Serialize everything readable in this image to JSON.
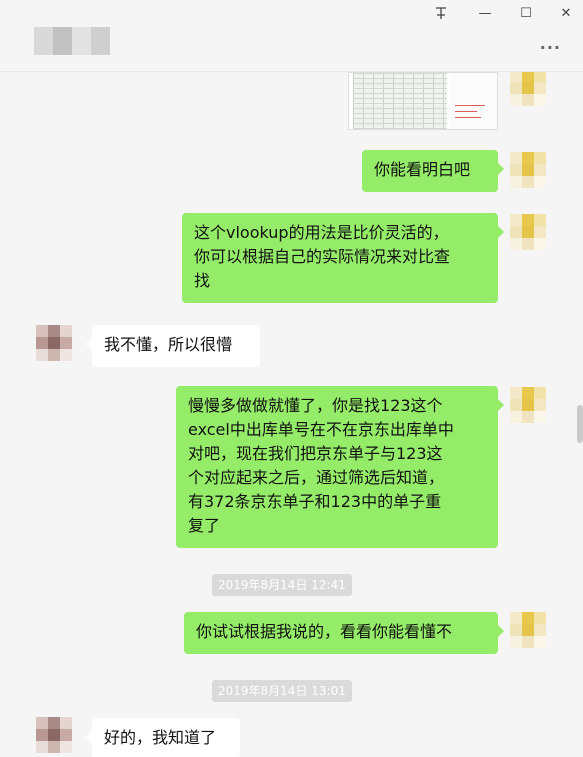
{
  "window": {
    "pin_icon": "pin-icon",
    "minimize_label": "—",
    "maximize_label": "☐",
    "close_label": "✕",
    "more_label": "···"
  },
  "messages": [
    {
      "id": "m1",
      "type": "image",
      "sender": "me"
    },
    {
      "id": "m2",
      "type": "text",
      "sender": "me",
      "text": "你能看明白吧"
    },
    {
      "id": "m3",
      "type": "text",
      "sender": "me",
      "lines": [
        "这个vlookup的用法是比价灵活的，",
        "你可以根据自己的实际情况来对比查",
        "找"
      ]
    },
    {
      "id": "m4",
      "type": "text",
      "sender": "them",
      "text": "我不懂，所以很懵"
    },
    {
      "id": "m5",
      "type": "text",
      "sender": "me",
      "lines": [
        "慢慢多做做就懂了，你是找123这个",
        "excel中出库单号在不在京东出库单中",
        "对吧，现在我们把京东单子与123这",
        "个对应起来之后，通过筛选后知道，",
        "有372条京东单子和123中的单子重",
        "复了"
      ]
    },
    {
      "id": "t1",
      "type": "timestamp",
      "text": "2019年8月14日 12:41"
    },
    {
      "id": "m6",
      "type": "text",
      "sender": "me",
      "text": "你试试根据我说的，看看你能看懂不"
    },
    {
      "id": "t2",
      "type": "timestamp",
      "text": "2019年8月14日 13:01"
    },
    {
      "id": "m7",
      "type": "text",
      "sender": "them",
      "text": "好的，我知道了"
    }
  ],
  "colors": {
    "my_bubble": "#95ec69",
    "their_bubble": "#ffffff",
    "background": "#f5f5f5",
    "timestamp_bg": "#dadada"
  }
}
